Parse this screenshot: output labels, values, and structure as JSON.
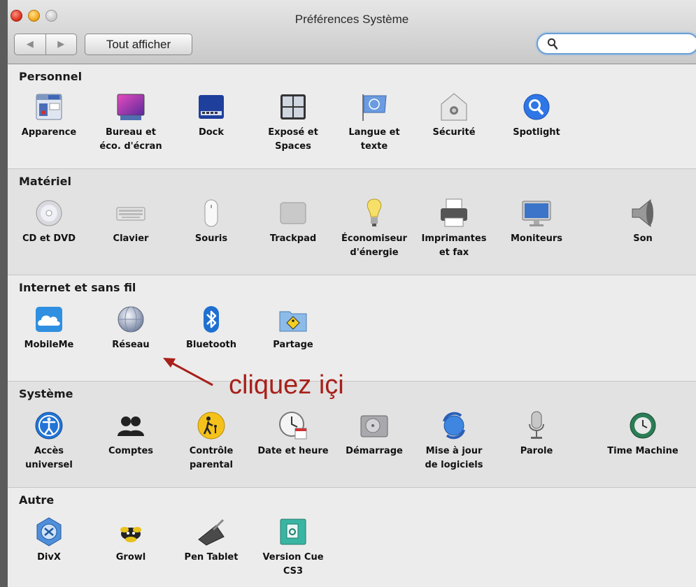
{
  "window": {
    "title": "Préférences Système",
    "show_all": "Tout afficher",
    "nav_back": "◀",
    "nav_forward": "▶",
    "search_value": ""
  },
  "sections": [
    {
      "title": "Personnel",
      "items": [
        {
          "label": "Apparence",
          "icon": "apparence-icon"
        },
        {
          "label": "Bureau et\néco. d'écran",
          "icon": "desktop-icon"
        },
        {
          "label": "Dock",
          "icon": "dock-icon"
        },
        {
          "label": "Exposé et\nSpaces",
          "icon": "expose-icon"
        },
        {
          "label": "Langue et\ntexte",
          "icon": "language-icon"
        },
        {
          "label": "Sécurité",
          "icon": "security-icon"
        },
        {
          "label": "Spotlight",
          "icon": "spotlight-icon"
        }
      ]
    },
    {
      "title": "Matériel",
      "items": [
        {
          "label": "CD et DVD",
          "icon": "cd-icon"
        },
        {
          "label": "Clavier",
          "icon": "keyboard-icon"
        },
        {
          "label": "Souris",
          "icon": "mouse-icon"
        },
        {
          "label": "Trackpad",
          "icon": "trackpad-icon"
        },
        {
          "label": "Économiseur\nd'énergie",
          "icon": "energy-icon"
        },
        {
          "label": "Imprimantes\net fax",
          "icon": "printer-icon"
        },
        {
          "label": "Moniteurs",
          "icon": "monitor-icon"
        },
        {
          "label": "Son",
          "icon": "speaker-icon"
        }
      ]
    },
    {
      "title": "Internet et sans fil",
      "items": [
        {
          "label": "MobileMe",
          "icon": "mobileme-icon"
        },
        {
          "label": "Réseau",
          "icon": "network-icon"
        },
        {
          "label": "Bluetooth",
          "icon": "bluetooth-icon"
        },
        {
          "label": "Partage",
          "icon": "sharing-icon"
        }
      ]
    },
    {
      "title": "Système",
      "items": [
        {
          "label": "Accès\nuniversel",
          "icon": "accessibility-icon"
        },
        {
          "label": "Comptes",
          "icon": "accounts-icon"
        },
        {
          "label": "Contrôle\nparental",
          "icon": "parental-icon"
        },
        {
          "label": "Date et heure",
          "icon": "clock-icon"
        },
        {
          "label": "Démarrage",
          "icon": "startup-disk-icon"
        },
        {
          "label": "Mise à jour\nde logiciels",
          "icon": "software-update-icon"
        },
        {
          "label": "Parole",
          "icon": "microphone-icon"
        },
        {
          "label": "Time Machine",
          "icon": "time-machine-icon"
        }
      ]
    },
    {
      "title": "Autre",
      "items": [
        {
          "label": "DivX",
          "icon": "divx-icon"
        },
        {
          "label": "Growl",
          "icon": "growl-icon"
        },
        {
          "label": "Pen Tablet",
          "icon": "pen-tablet-icon"
        },
        {
          "label": "Version Cue\nCS3",
          "icon": "version-cue-icon"
        }
      ]
    }
  ],
  "annotation": {
    "text": "cliquez içi",
    "color": "#a8201a"
  }
}
